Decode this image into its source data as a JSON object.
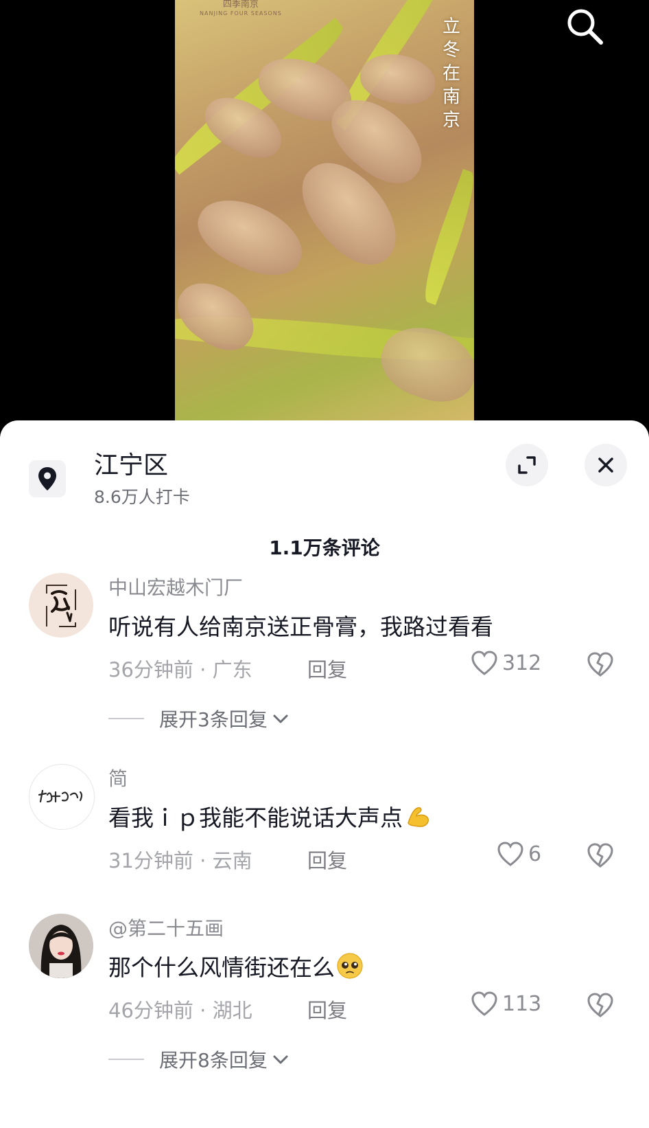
{
  "video": {
    "brand": "四季南京",
    "brand_sub": "NANJING FOUR SEASONS",
    "vertical_text": "立冬\n在南京"
  },
  "panel": {
    "location_title": "江宁区",
    "location_checkins": "8.6万人打卡",
    "comment_count": "1.1万条评论"
  },
  "comments": [
    {
      "username": "中山宏越木门厂",
      "text": "听说有人给南京送正骨膏，我路过看看",
      "time": "36分钟前",
      "region": "广东",
      "reply_label": "回复",
      "likes": "312",
      "expand_label": "展开3条回复"
    },
    {
      "username": "简",
      "text": "看我ｉｐ我能不能说话大声点",
      "emoji": "flexed-biceps",
      "time": "31分钟前",
      "region": "云南",
      "reply_label": "回复",
      "likes": "6"
    },
    {
      "username": "@第二十五画",
      "text": "那个什么风情街还在么",
      "emoji": "pleading-face",
      "time": "46分钟前",
      "region": "湖北",
      "reply_label": "回复",
      "likes": "113",
      "expand_label": "展开8条回复"
    }
  ],
  "colors": {
    "primary_text": "#161823",
    "secondary_text": "#8a8b91",
    "panel_bg": "#ffffff",
    "page_bg": "#000000"
  }
}
